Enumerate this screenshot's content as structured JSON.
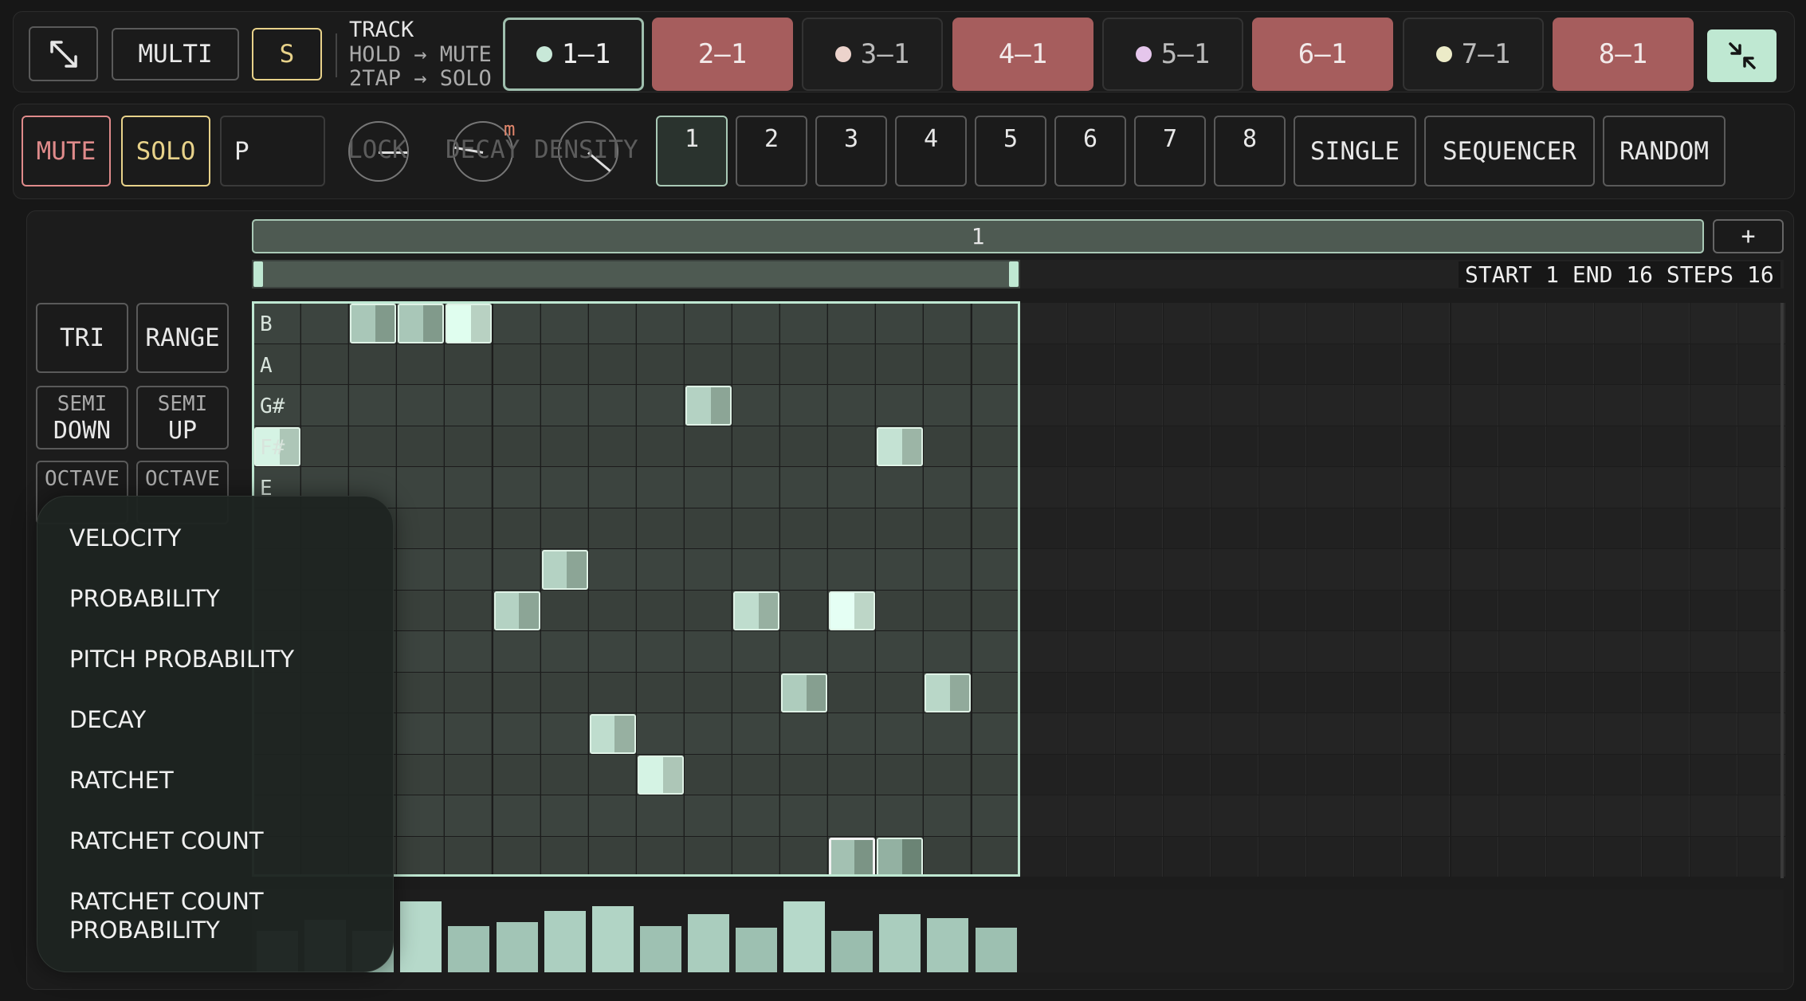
{
  "topbar": {
    "expand_icon": "expand-arrows-icon",
    "multi_label": "MULTI",
    "s_label": "S",
    "track_help": {
      "line1": "TRACK",
      "line2": "HOLD → MUTE",
      "line3": "2TAP → SOLO"
    },
    "tracks": [
      {
        "label": "1–1",
        "style": "selected",
        "dot": "#c8e8d8"
      },
      {
        "label": "2–1",
        "style": "red"
      },
      {
        "label": "3–1",
        "style": "light",
        "dot": "#ecd3cc"
      },
      {
        "label": "4–1",
        "style": "red"
      },
      {
        "label": "5–1",
        "style": "light",
        "dot": "#e5c6ec"
      },
      {
        "label": "6–1",
        "style": "red"
      },
      {
        "label": "7–1",
        "style": "light",
        "dot": "#ecebc8"
      },
      {
        "label": "8–1",
        "style": "red"
      }
    ],
    "collapse_icon": "collapse-arrows-icon"
  },
  "controls": {
    "mute_label": "MUTE",
    "solo_label": "SOLO",
    "p_label": "P",
    "knobs": [
      {
        "label": "LOCK",
        "angle": 0
      },
      {
        "label": "DECAY",
        "angle": 190,
        "badge": "m"
      },
      {
        "label": "DENSITY",
        "angle": 40
      }
    ],
    "patterns": [
      "1",
      "2",
      "3",
      "4",
      "5",
      "6",
      "7",
      "8"
    ],
    "selected_pattern": "1",
    "mode_buttons": [
      "SINGLE",
      "SEQUENCER",
      "RANDOM"
    ]
  },
  "editor": {
    "page_label": "1",
    "add_label": "+",
    "range_info": "START 1 END 16 STEPS 16",
    "side_buttons": {
      "tri": "TRI",
      "range": "RANGE",
      "semi_down": [
        "SEMI",
        "DOWN"
      ],
      "semi_up": [
        "SEMI",
        "UP"
      ],
      "octave_down": "OCTAVE",
      "octave_up": "OCTAVE"
    },
    "row_labels": [
      "B",
      "A",
      "G#",
      "F#",
      "E"
    ],
    "notes": [
      {
        "step": 3,
        "row": 0,
        "level": 0.35
      },
      {
        "step": 4,
        "row": 0,
        "level": 0.35
      },
      {
        "step": 5,
        "row": 0,
        "level": 0.85
      },
      {
        "step": 10,
        "row": 2,
        "level": 0.45
      },
      {
        "step": 1,
        "row": 3,
        "level": 0.75
      },
      {
        "step": 14,
        "row": 3,
        "level": 0.6
      },
      {
        "step": 7,
        "row": 6,
        "level": 0.45
      },
      {
        "step": 6,
        "row": 7,
        "level": 0.45
      },
      {
        "step": 11,
        "row": 7,
        "level": 0.55
      },
      {
        "step": 13,
        "row": 7,
        "level": 0.9
      },
      {
        "step": 12,
        "row": 9,
        "level": 0.4
      },
      {
        "step": 15,
        "row": 9,
        "level": 0.5
      },
      {
        "step": 8,
        "row": 10,
        "level": 0.55
      },
      {
        "step": 9,
        "row": 11,
        "level": 0.75
      },
      {
        "step": 13,
        "row": 13,
        "level": 0.3,
        "cursor": true
      },
      {
        "step": 14,
        "row": 13,
        "level": 0.15
      }
    ],
    "velocity_bars": [
      0.55,
      0.7,
      0.55,
      0.95,
      0.62,
      0.67,
      0.82,
      0.88,
      0.62,
      0.78,
      0.6,
      0.95,
      0.55,
      0.78,
      0.72,
      0.6
    ]
  },
  "menu": {
    "items": [
      "VELOCITY",
      "PROBABILITY",
      "PITCH PROBABILITY",
      "DECAY",
      "RATCHET",
      "RATCHET COUNT",
      "RATCHET COUNT\nPROBABILITY"
    ]
  },
  "colors": {
    "accent": "#a9c9b6",
    "red_track": "#a65d5d",
    "mute": "#e08b8b",
    "solo": "#e8d28a",
    "active_grid": "#3c443f",
    "inactive_grid": "#222222"
  }
}
